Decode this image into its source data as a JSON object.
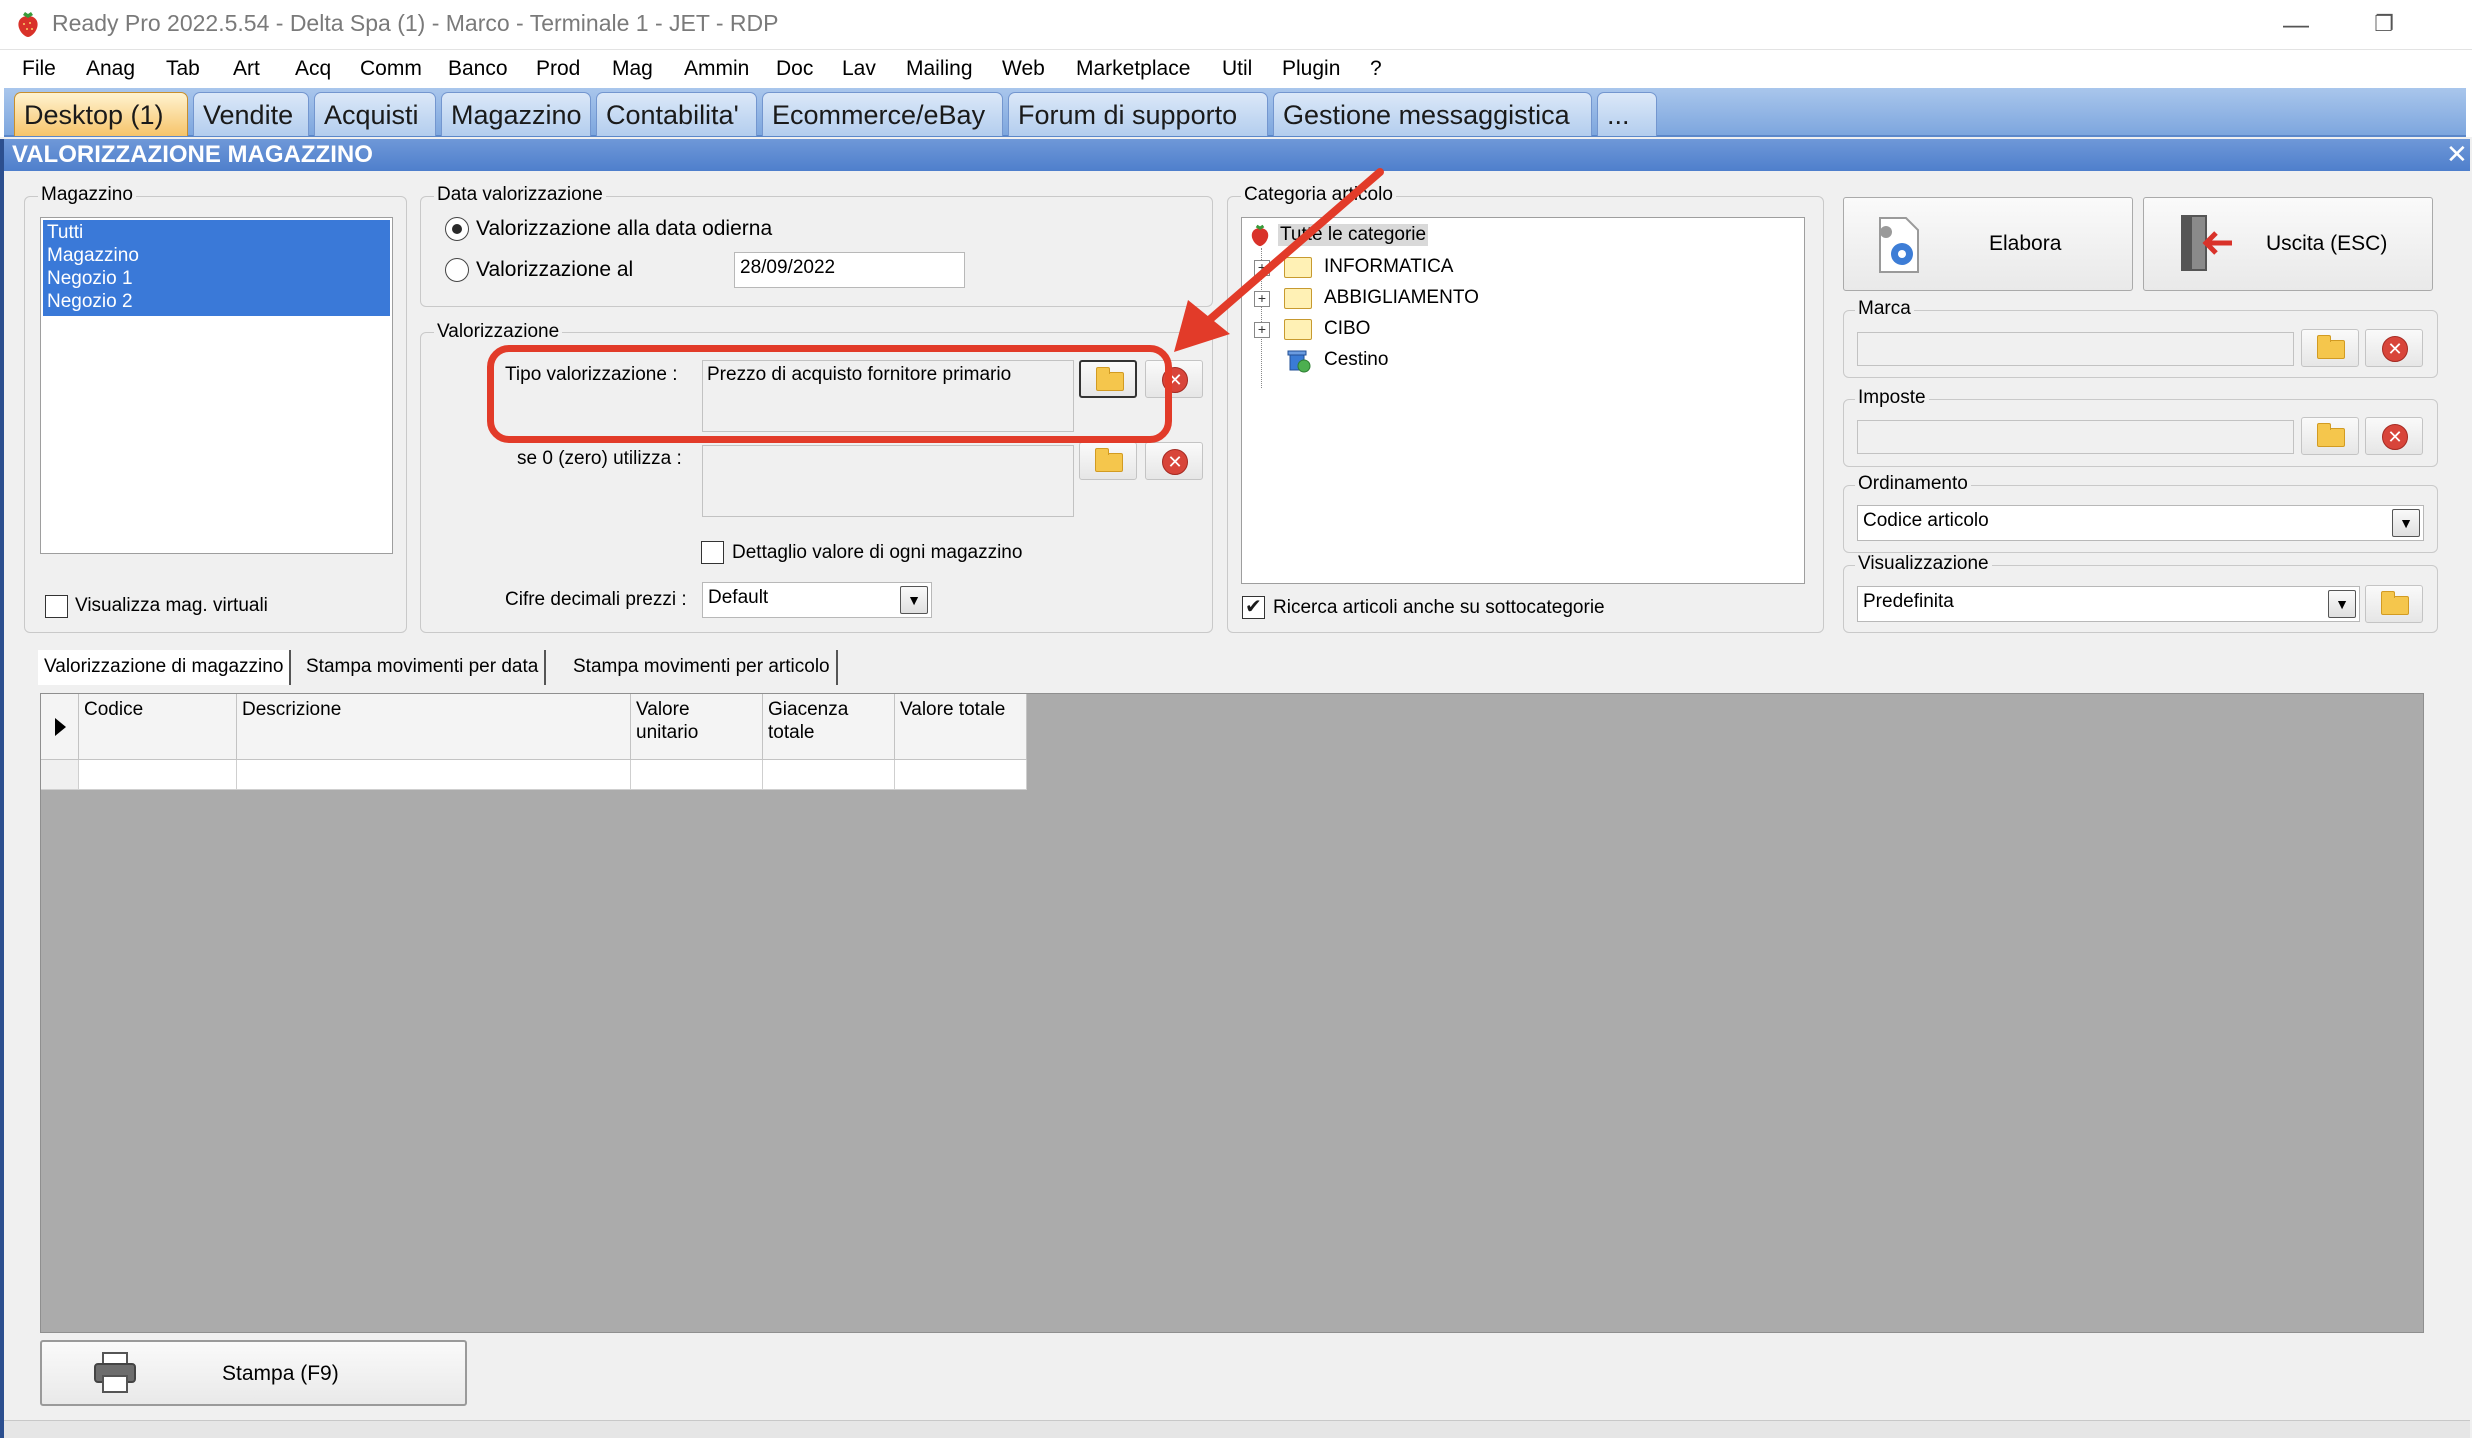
{
  "window": {
    "title": "Ready Pro 2022.5.54 - Delta Spa (1) - Marco - Terminale 1 - JET - RDP",
    "minimize": "—",
    "restore": "❐"
  },
  "menu": [
    "File",
    "Anag",
    "Tab",
    "Art",
    "Acq",
    "Comm",
    "Banco",
    "Prod",
    "Mag",
    "Ammin",
    "Doc",
    "Lav",
    "Mailing",
    "Web",
    "Marketplace",
    "Util",
    "Plugin",
    "?"
  ],
  "nav_tabs": [
    "Desktop (1)",
    "Vendite",
    "Acquisti",
    "Magazzino",
    "Contabilita'",
    "Ecommerce/eBay",
    "Forum di supporto",
    "Gestione messaggistica",
    "..."
  ],
  "form": {
    "title": "VALORIZZAZIONE MAGAZZINO",
    "close": "✕"
  },
  "magazzino": {
    "label": "Magazzino",
    "items": [
      "Tutti",
      "Magazzino",
      "Negozio 1",
      "Negozio 2"
    ],
    "virtual_label": "Visualizza mag. virtuali"
  },
  "data_valorizzazione": {
    "label": "Data valorizzazione",
    "opt_today": "Valorizzazione alla data odierna",
    "opt_date": "Valorizzazione al",
    "date_value": "28/09/2022"
  },
  "valorizzazione": {
    "label": "Valorizzazione",
    "tipo_label": "Tipo valorizzazione :",
    "tipo_value": "Prezzo di acquisto fornitore primario",
    "zero_label": "se 0 (zero) utilizza :",
    "zero_value": "",
    "detail_label": "Dettaglio valore di ogni magazzino",
    "cifre_label": "Cifre decimali prezzi :",
    "cifre_value": "Default"
  },
  "categoria": {
    "label": "Categoria articolo",
    "root": "Tutte le categorie",
    "items": [
      "INFORMATICA",
      "ABBIGLIAMENTO",
      "CIBO"
    ],
    "trash": "Cestino",
    "subcat_label": "Ricerca articoli anche su sottocategorie"
  },
  "actions": {
    "elabora": "Elabora",
    "uscita": "Uscita (ESC)",
    "marca_label": "Marca",
    "imposte_label": "Imposte",
    "ordinamento_label": "Ordinamento",
    "ordinamento_value": "Codice articolo",
    "visualizzazione_label": "Visualizzazione",
    "visualizzazione_value": "Predefinita"
  },
  "sub_tabs": [
    "Valorizzazione di magazzino",
    "Stampa movimenti per data",
    "Stampa movimenti per articolo"
  ],
  "grid": {
    "columns": [
      "Codice",
      "Descrizione",
      "Valore unitario",
      "Giacenza totale",
      "Valore totale"
    ]
  },
  "print_label": "Stampa (F9)",
  "colors": {
    "accent_blue": "#4f7fcc",
    "selection_blue": "#3a79d8",
    "annotation_red": "#e23b29"
  }
}
